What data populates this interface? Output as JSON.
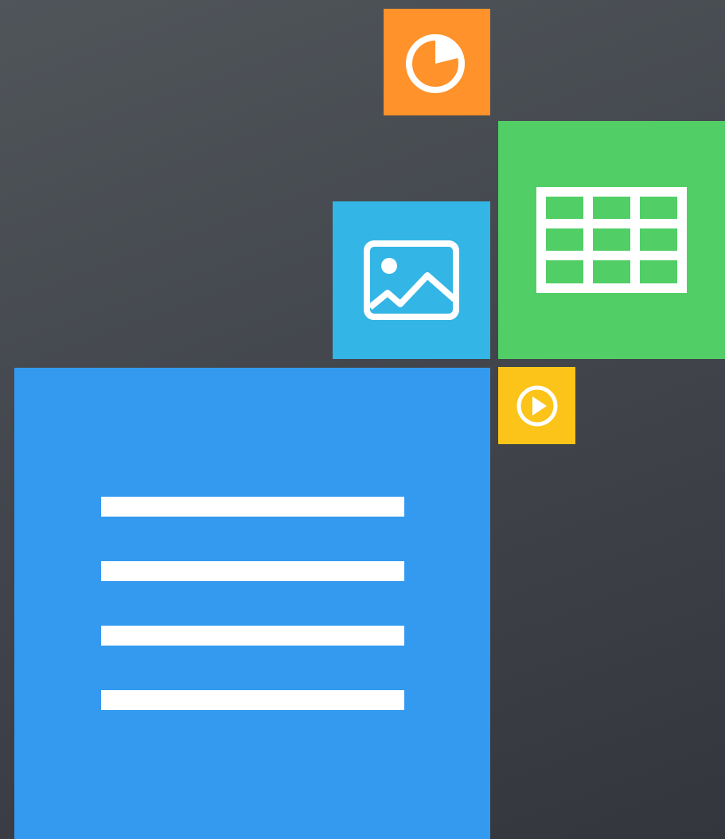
{
  "background": {
    "colors": [
      "#50555a",
      "#33363d"
    ]
  },
  "tiles": [
    {
      "id": "tile-chart",
      "icon": "pie-chart-icon",
      "color": "#ff922b"
    },
    {
      "id": "tile-table",
      "icon": "table-icon",
      "color": "#51cf66"
    },
    {
      "id": "tile-image",
      "icon": "image-icon",
      "color": "#33b5e5"
    },
    {
      "id": "tile-video",
      "icon": "play-icon",
      "color": "#fcc419"
    },
    {
      "id": "tile-document",
      "icon": "document-icon",
      "color": "#339af0"
    }
  ],
  "icon_color": "#ffffff"
}
